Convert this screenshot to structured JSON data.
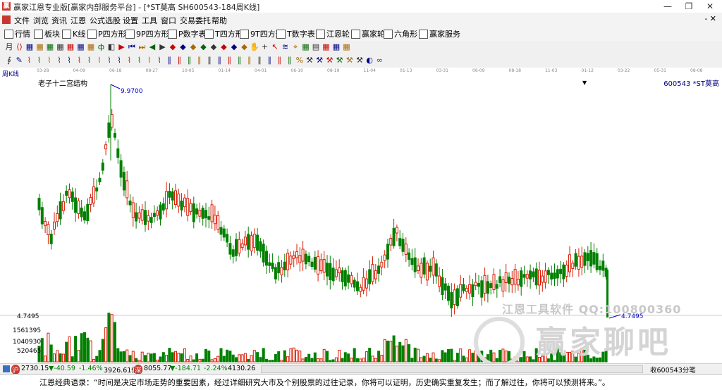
{
  "window": {
    "title": "赢家江恩专业版[赢家内部服务平台] - [*ST莫高  SH600543-184周K线]",
    "min": "—",
    "max": "❐",
    "close": "✕"
  },
  "menu": [
    "文件",
    "浏览",
    "资讯",
    "江恩",
    "公式选股",
    "设置",
    "工具",
    "窗口",
    "交易委托",
    "帮助"
  ],
  "menu_close": "- ✕",
  "toolbar1": [
    {
      "icon": "grid-icon",
      "label": "行情"
    },
    {
      "icon": "blocks-icon",
      "label": "板块"
    },
    {
      "icon": "candles-icon",
      "label": "K线"
    },
    {
      "icon": "p-square-icon",
      "label": "P四方形"
    },
    {
      "icon": "9p-square-icon",
      "label": "9P四方形"
    },
    {
      "icon": "p-number-icon",
      "label": "P数字表"
    },
    {
      "icon": "t-square-icon",
      "label": "T四方形"
    },
    {
      "icon": "9t-square-icon",
      "label": "9T四方形"
    },
    {
      "icon": "t-number-icon",
      "label": "T数字表"
    },
    {
      "icon": "gann-wheel-icon",
      "label": "江恩轮"
    },
    {
      "icon": "winner-wheel-icon",
      "label": "赢家轮"
    },
    {
      "icon": "hexagon-icon",
      "label": "六角形"
    },
    {
      "icon": "service-icon",
      "label": "赢家服务"
    }
  ],
  "toolbar2_glyphs": [
    "月",
    "⟨⟩",
    "▦",
    "▦",
    "▦",
    "▦",
    "▦",
    "▦",
    "▦",
    "ф",
    "◧",
    "▶",
    "⏮",
    "⏭",
    "◀",
    "▶",
    "◆",
    "◆",
    "◆",
    "◆",
    "◆",
    "◆",
    "◆",
    "◆",
    "✋",
    "+",
    "↖",
    "≋",
    "⌖",
    "▦",
    "▤",
    "▦",
    "▦",
    "▦"
  ],
  "toolbar3_glyphs": [
    "∮",
    "✎",
    "⌇",
    "⌇",
    "⌇",
    "⌇",
    "⌇",
    "⌇",
    "⌇",
    "⌇",
    "⌇",
    "⌇",
    "⌇",
    "⌇",
    "⌇",
    "⌇",
    "∥",
    "∥",
    "∥",
    "∥",
    "∥",
    "∥",
    "∥",
    "∥",
    "∥",
    "∥",
    "∥",
    "∥",
    "∥",
    "%",
    "⚒",
    "⚒",
    "⚒",
    "⚒",
    "⚒",
    "⚒",
    "◐",
    "∞"
  ],
  "timeline": {
    "label": "周K线",
    "ticks": [
      "03-28",
      "04-09",
      "06-18",
      "08-27",
      "10-05",
      "01-14",
      "04-01",
      "06-10",
      "08-19",
      "11-04",
      "01-13",
      "03-31",
      "06-09",
      "08-18",
      "11-03",
      "01-12",
      "03-22",
      "05-31",
      "08-08"
    ]
  },
  "chart_header": {
    "indicator": "老子十二宫结构",
    "stock": "600543 *ST莫高",
    "dropdown": "▼"
  },
  "chart_data": {
    "type": "candlestick",
    "price_high": 9.97,
    "price_low": 4.7495,
    "high_label": "9.9700",
    "low_label": "4.7495",
    "volume_ticks": [
      "1561395",
      "1040930",
      "520465"
    ],
    "up_color": "#d81e06",
    "down_color": "#008000"
  },
  "status": {
    "index1_icon": "沪",
    "index1": "2730.15",
    "index1_chg": "▼-40.59",
    "index1_pct": "-1.46%",
    "index1_vol": "3926.61亿",
    "index2_icon": "深",
    "index2": "8055.77",
    "index2_chg": "▼-184.71",
    "index2_pct": "-2.24%",
    "index2_vol": "4130.26",
    "right_info": "收600543分笔"
  },
  "quote": "江恩经典语录：“时间是决定市场走势的重要因素，经过详细研究大市及个别股票的过往记录，你将可以证明，历史确实重复发生；而了解过往，你将可以预测将来。”。",
  "watermark": {
    "line1": "江恩工具软件  QQ:100800360",
    "line2": "赢家聊吧"
  }
}
